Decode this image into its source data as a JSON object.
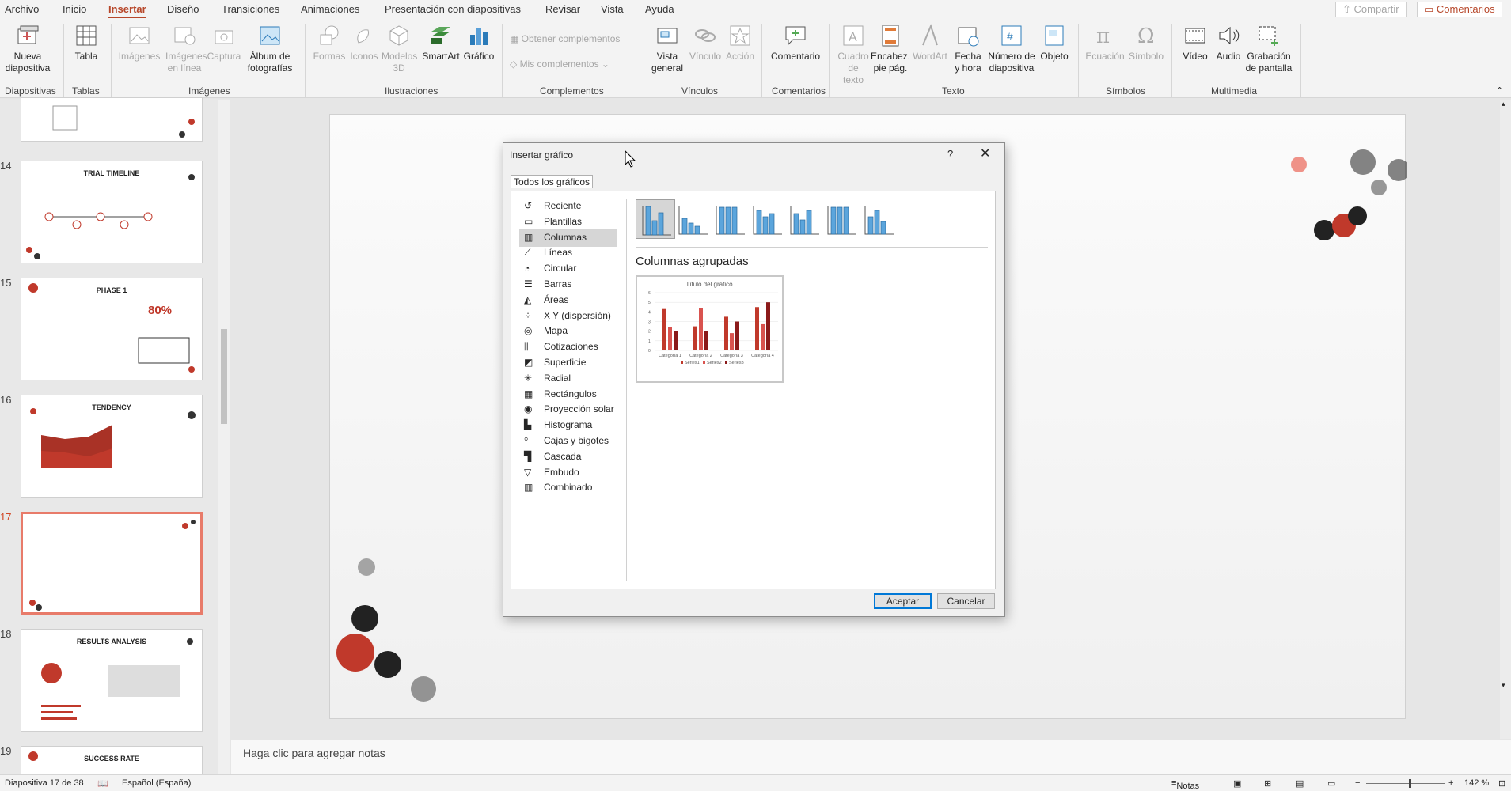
{
  "tabs": [
    "Archivo",
    "Inicio",
    "Insertar",
    "Diseño",
    "Transiciones",
    "Animaciones",
    "Presentación con diapositivas",
    "Revisar",
    "Vista",
    "Ayuda"
  ],
  "active_tab": "Insertar",
  "header_buttons": {
    "share": "Compartir",
    "comments": "Comentarios"
  },
  "ribbon": {
    "nueva_diapositiva": "Nueva diapositiva",
    "tabla": "Tabla",
    "imagenes": "Imágenes",
    "imagenes_en_linea": "Imágenes en línea",
    "captura": "Captura",
    "album": "Álbum de fotografías",
    "formas": "Formas",
    "iconos": "Iconos",
    "modelos3d": "Modelos 3D",
    "smartart": "SmartArt",
    "grafico": "Gráfico",
    "obtener_complementos": "Obtener complementos",
    "mis_complementos": "Mis complementos",
    "vista_general": "Vista general",
    "vinculo": "Vínculo",
    "accion": "Acción",
    "comentario": "Comentario",
    "cuadro_texto": "Cuadro de texto",
    "encabez": "Encabez. pie pág.",
    "wordart": "WordArt",
    "fecha": "Fecha y hora",
    "numero": "Número de diapositiva",
    "objeto": "Objeto",
    "ecuacion": "Ecuación",
    "simbolo": "Símbolo",
    "video": "Vídeo",
    "audio": "Audio",
    "grabacion": "Grabación de pantalla"
  },
  "groups": [
    "Diapositivas",
    "Tablas",
    "Imágenes",
    "Ilustraciones",
    "Complementos",
    "Vínculos",
    "Comentarios",
    "Texto",
    "Símbolos",
    "Multimedia"
  ],
  "thumbnails": [
    {
      "num": "14",
      "title": "TRIAL TIMELINE"
    },
    {
      "num": "15",
      "title": "PHASE 1",
      "value": "80%"
    },
    {
      "num": "16",
      "title": "TENDENCY"
    },
    {
      "num": "17",
      "title": ""
    },
    {
      "num": "18",
      "title": "RESULTS ANALYSIS"
    },
    {
      "num": "19",
      "title": "SUCCESS RATE"
    }
  ],
  "notes_placeholder": "Haga clic para agregar notas",
  "status": {
    "slide": "Diapositiva 17 de 38",
    "language": "Español (España)",
    "notes": "Notas",
    "zoom": "142 %"
  },
  "dialog": {
    "title": "Insertar gráfico",
    "help": "?",
    "tab": "Todos los gráficos",
    "categories": [
      "Reciente",
      "Plantillas",
      "Columnas",
      "Líneas",
      "Circular",
      "Barras",
      "Áreas",
      "X Y (dispersión)",
      "Mapa",
      "Cotizaciones",
      "Superficie",
      "Radial",
      "Rectángulos",
      "Proyección solar",
      "Histograma",
      "Cajas y bigotes",
      "Cascada",
      "Embudo",
      "Combinado"
    ],
    "selected_category": "Columnas",
    "subtype_title": "Columnas agrupadas",
    "ok": "Aceptar",
    "cancel": "Cancelar"
  },
  "chart_data": {
    "type": "bar",
    "title": "Título del gráfico",
    "categories": [
      "Categoría 1",
      "Categoría 2",
      "Categoría 3",
      "Categoría 4"
    ],
    "series": [
      {
        "name": "Series1",
        "values": [
          4.3,
          2.5,
          3.5,
          4.5
        ],
        "color": "#c0392b"
      },
      {
        "name": "Series2",
        "values": [
          2.4,
          4.4,
          1.8,
          2.8
        ],
        "color": "#d9534f"
      },
      {
        "name": "Series3",
        "values": [
          2,
          2,
          3,
          5
        ],
        "color": "#8b1a1a"
      }
    ],
    "ylim": [
      0,
      6
    ],
    "yticks": [
      "0",
      "1",
      "2",
      "3",
      "4",
      "5",
      "6"
    ],
    "legend": "bottom"
  }
}
